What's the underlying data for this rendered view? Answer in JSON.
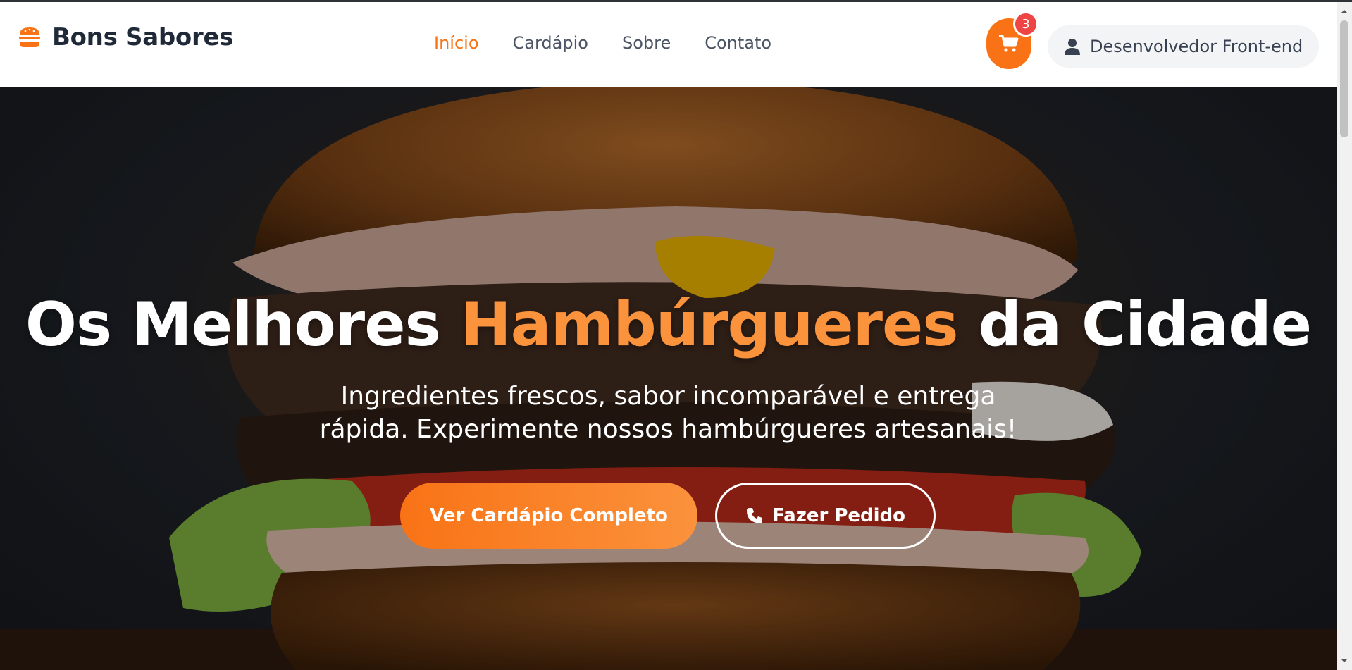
{
  "brand": {
    "name": "Bons Sabores",
    "icon": "burger-icon",
    "accent": "#f97316"
  },
  "nav": {
    "items": [
      {
        "label": "Início",
        "active": true
      },
      {
        "label": "Cardápio",
        "active": false
      },
      {
        "label": "Sobre",
        "active": false
      },
      {
        "label": "Contato",
        "active": false
      }
    ]
  },
  "cart": {
    "icon": "cart-icon",
    "count": "3",
    "badge_color": "#ef4444"
  },
  "user": {
    "icon": "user-icon",
    "label": "Desenvolvedor Front-end"
  },
  "hero": {
    "title_before": "Os Melhores ",
    "title_highlight": "Hambúrgueres",
    "title_after": " da Cidade",
    "subtitle": "Ingredientes frescos, sabor incomparável e entrega rápida. Experimente nossos hambúrgueres artesanais!",
    "primary_button": "Ver Cardápio Completo",
    "secondary_button": "Fazer Pedido",
    "secondary_icon": "phone-icon"
  }
}
